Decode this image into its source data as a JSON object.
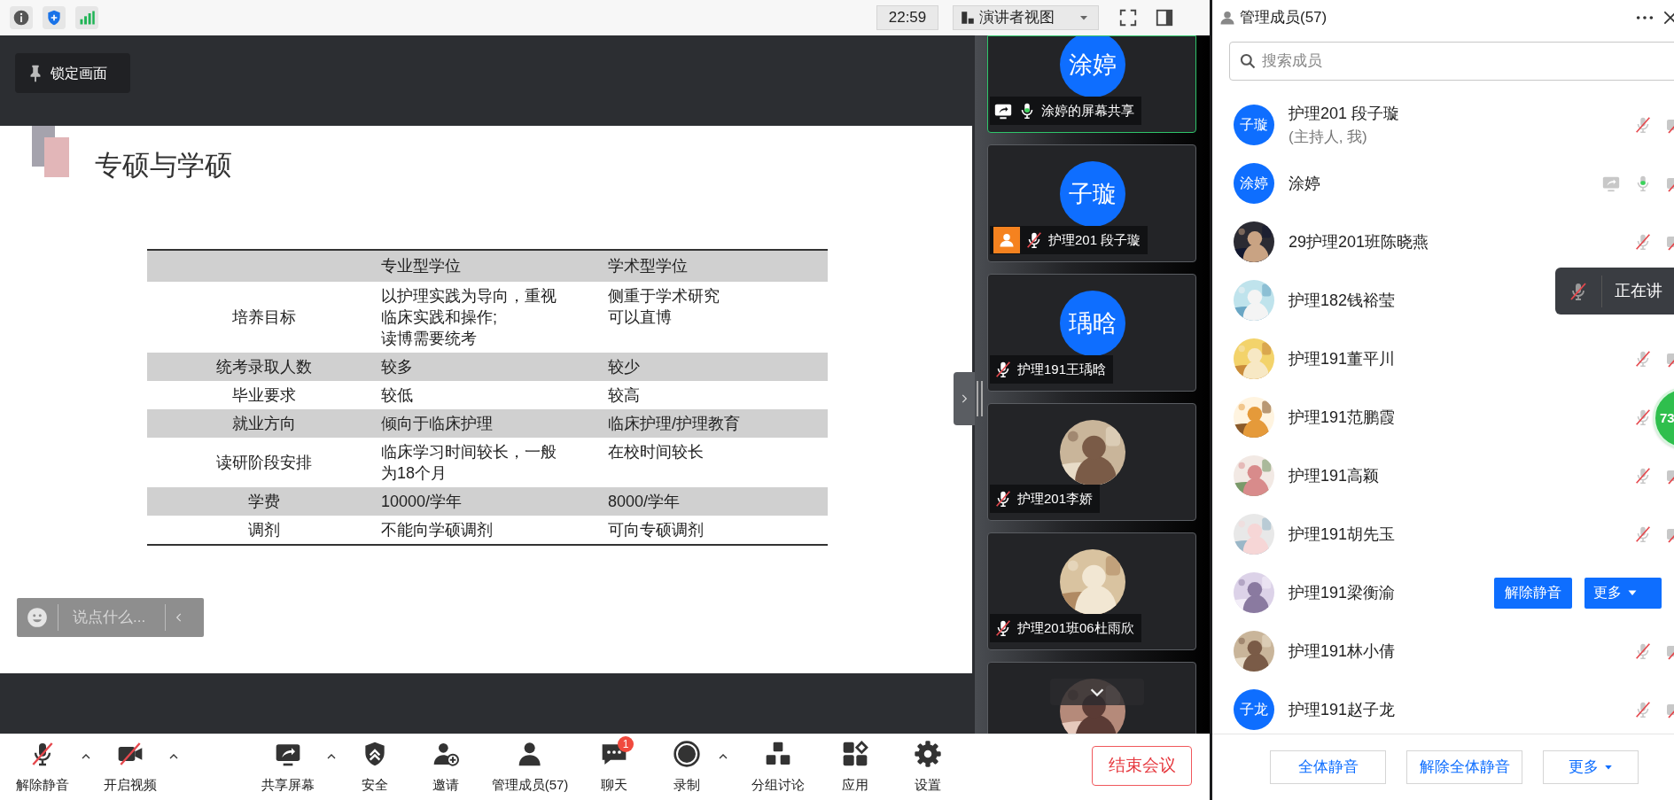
{
  "top_bar": {
    "time": "22:59",
    "view_menu": "演讲者视图"
  },
  "shared_screen": {
    "lock_button": "锁定画面",
    "slide": {
      "title": "专硕与学硕",
      "table": {
        "columns": [
          "",
          "专业型学位",
          "学术型学位"
        ],
        "rows": [
          [
            [
              "培养目标"
            ],
            [
              "以护理实践为导向，重视",
              "临床实践和操作;",
              "读博需要统考"
            ],
            [
              "侧重于学术研究",
              "可以直博"
            ]
          ],
          [
            [
              "统考录取人数"
            ],
            [
              "较多"
            ],
            [
              "较少"
            ]
          ],
          [
            [
              "毕业要求"
            ],
            [
              "较低"
            ],
            [
              "较高"
            ]
          ],
          [
            [
              "就业方向"
            ],
            [
              "倾向于临床护理"
            ],
            [
              "临床护理/护理教育"
            ]
          ],
          [
            [
              "读研阶段安排"
            ],
            [
              "临床学习时间较长，一般",
              "为18个月"
            ],
            [
              "在校时间较长"
            ]
          ],
          [
            [
              "学费"
            ],
            [
              "10000/学年"
            ],
            [
              "8000/学年"
            ]
          ],
          [
            [
              "调剂"
            ],
            [
              "不能向学硕调剂"
            ],
            [
              "可向专硕调剂"
            ]
          ]
        ]
      }
    },
    "chat_input": {
      "placeholder": "说点什么..."
    }
  },
  "video_tiles": [
    {
      "name": "涂婷的屏幕共享",
      "avatar": {
        "kind": "initials",
        "text": "涂婷"
      },
      "muted": false,
      "sharing": true,
      "host": false,
      "active": true
    },
    {
      "name": "护理201 段子璇",
      "avatar": {
        "kind": "initials",
        "text": "子璇"
      },
      "muted": true,
      "sharing": false,
      "host": true,
      "active": false
    },
    {
      "name": "护理191王瑀晗",
      "avatar": {
        "kind": "initials",
        "text": "瑀晗"
      },
      "muted": true,
      "sharing": false,
      "host": false,
      "active": false
    },
    {
      "name": "护理201李娇",
      "avatar": {
        "kind": "picture"
      },
      "muted": true,
      "sharing": false,
      "host": false,
      "active": false
    },
    {
      "name": "护理201班06杜雨欣",
      "avatar": {
        "kind": "picture"
      },
      "muted": true,
      "sharing": false,
      "host": false,
      "active": false
    },
    {
      "avatar": {
        "kind": "picture"
      },
      "active": false
    }
  ],
  "toolbar": {
    "items": [
      {
        "label": "解除静音",
        "caret": true
      },
      {
        "label": "开启视频",
        "caret": true
      },
      {
        "label": "共享屏幕",
        "caret": true
      },
      {
        "label": "安全",
        "caret": false
      },
      {
        "label": "邀请",
        "caret": false
      },
      {
        "label": "管理成员(57)",
        "caret": false
      },
      {
        "label": "聊天",
        "caret": false,
        "badge": "1"
      },
      {
        "label": "录制",
        "caret": true
      },
      {
        "label": "分组讨论",
        "caret": false
      },
      {
        "label": "应用",
        "caret": false
      },
      {
        "label": "设置",
        "caret": false
      }
    ],
    "end_button": "结束会议"
  },
  "members_panel": {
    "title": "管理成员(57)",
    "search_placeholder": "搜索成员",
    "members": [
      {
        "name": "护理201 段子璇",
        "note": "(主持人, 我)",
        "avatar": {
          "kind": "initials",
          "text": "子璇"
        },
        "muted": true,
        "camera_off": true,
        "sharing": false
      },
      {
        "name": "涂婷",
        "avatar": {
          "kind": "initials",
          "text": "涂婷"
        },
        "muted": false,
        "camera_off": true,
        "sharing": true
      },
      {
        "name": "29护理201班陈晓燕",
        "avatar": {
          "kind": "picture"
        },
        "muted": true,
        "camera_off": true,
        "sharing": false
      },
      {
        "name": "护理182钱裕莹",
        "avatar": {
          "kind": "picture"
        },
        "sharing": false
      },
      {
        "name": "护理191董平川",
        "avatar": {
          "kind": "picture"
        },
        "muted": true,
        "camera_off": true,
        "sharing": false
      },
      {
        "name": "护理191范鹏霞",
        "avatar": {
          "kind": "picture"
        },
        "muted": true,
        "sharing": false
      },
      {
        "name": "护理191高颖",
        "avatar": {
          "kind": "picture"
        },
        "muted": true,
        "camera_off": true,
        "sharing": false
      },
      {
        "name": "护理191胡先玉",
        "avatar": {
          "kind": "picture"
        },
        "muted": true,
        "camera_off": true,
        "sharing": false
      },
      {
        "name": "护理191梁衡渝",
        "avatar": {
          "kind": "picture"
        },
        "sharing": false,
        "actions": [
          "解除静音",
          "更多"
        ]
      },
      {
        "name": "护理191林小倩",
        "avatar": {
          "kind": "picture"
        },
        "muted": true,
        "camera_off": true,
        "sharing": false
      },
      {
        "name": "护理191赵子龙",
        "avatar": {
          "kind": "initials",
          "text": "子龙"
        },
        "muted": true,
        "camera_off": true,
        "sharing": false
      }
    ],
    "tooltip": "正在讲",
    "floating_badge": "73",
    "footer_buttons": [
      "全体静音",
      "解除全体静音",
      "更多"
    ]
  }
}
